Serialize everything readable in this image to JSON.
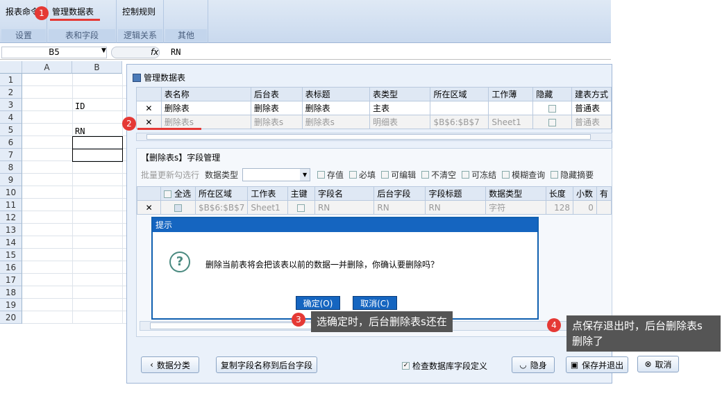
{
  "ribbon": {
    "btn_report_cmd": "报表命令",
    "btn_manage_tables": "管理数据表",
    "btn_control_rules": "控制规则",
    "group_settings": "设置",
    "group_tables_fields": "表和字段",
    "group_logic": "逻辑关系",
    "group_other": "其他"
  },
  "formula_bar": {
    "cell_ref": "B5",
    "fx": "fx",
    "value": "RN"
  },
  "sheet": {
    "col_a": "A",
    "col_b": "B",
    "rows": [
      "1",
      "2",
      "3",
      "4",
      "5",
      "6",
      "7",
      "8",
      "9",
      "10",
      "11",
      "12",
      "13",
      "14",
      "15",
      "16",
      "17",
      "18",
      "19",
      "20"
    ],
    "b3": "ID",
    "b5": "RN"
  },
  "manager": {
    "title": "管理数据表",
    "table_headers": [
      "表名称",
      "后台表",
      "表标题",
      "表类型",
      "所在区域",
      "工作薄",
      "隐藏",
      "建表方式"
    ],
    "rows": [
      {
        "del": "✕",
        "name": "删除表",
        "backend": "删除表",
        "caption": "删除表",
        "type": "主表",
        "area": "",
        "book": "",
        "mode": "普通表"
      },
      {
        "del": "✕",
        "name": "删除表s",
        "backend": "删除表s",
        "caption": "删除表s",
        "type": "明细表",
        "area": "$B$6:$B$7",
        "book": "Sheet1",
        "mode": "普通表"
      }
    ],
    "field_panel_title": "【删除表s】字段管理",
    "batch_update": "批量更新勾选行",
    "data_type_label": "数据类型",
    "checks": [
      "存值",
      "必填",
      "可编辑",
      "不清空",
      "可冻结",
      "模糊查询",
      "隐藏摘要"
    ],
    "field_headers": [
      "全选",
      "所在区域",
      "工作表",
      "主键",
      "字段名",
      "后台字段",
      "字段标题",
      "数据类型",
      "长度",
      "小数",
      "有"
    ],
    "field_row": {
      "del": "✕",
      "area": "$B$6:$B$7",
      "sheet": "Sheet1",
      "name": "RN",
      "backend": "RN",
      "title": "RN",
      "dtype": "字符",
      "len": "128",
      "dec": "0"
    },
    "btn_classify": "数据分类",
    "btn_copy_names": "复制字段名称到后台字段",
    "check_db_label": "检查数据库字段定义",
    "btn_hide": "隐身",
    "btn_save_exit": "保存并退出",
    "btn_cancel": "取消"
  },
  "dialog": {
    "title": "提示",
    "message": "删除当前表将会把该表以前的数据一并删除，你确认要删除吗？",
    "ok": "确定(O)",
    "cancel": "取消(C)"
  },
  "annotations": {
    "badge1": "1",
    "badge2": "2",
    "badge3": "3",
    "badge4": "4",
    "tip3": "选确定时，后台删除表s还在",
    "tip4_line1": "点保存退出时，后台删除表s",
    "tip4_line2": "删除了"
  },
  "colors": {
    "accent": "#1565c0",
    "badge": "#e53935"
  }
}
